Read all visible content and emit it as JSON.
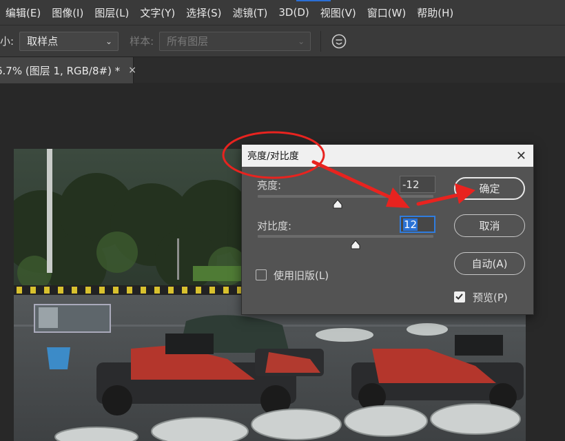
{
  "menubar": {
    "items": [
      {
        "label": "编辑(E)"
      },
      {
        "label": "图像(I)"
      },
      {
        "label": "图层(L)"
      },
      {
        "label": "文字(Y)"
      },
      {
        "label": "选择(S)"
      },
      {
        "label": "滤镜(T)"
      },
      {
        "label": "3D(D)"
      },
      {
        "label": "视图(V)"
      },
      {
        "label": "窗口(W)"
      },
      {
        "label": "帮助(H)"
      }
    ]
  },
  "options": {
    "size_label": "小:",
    "sample_size_value": "取样点",
    "sample_label": "样本:",
    "sample_value": "所有图层",
    "accent_color": "#2b6fd6"
  },
  "tab": {
    "title": "6.7% (图层 1, RGB/8#) *",
    "close_glyph": "×"
  },
  "dialog": {
    "title": "亮度/对比度",
    "close_glyph": "✕",
    "brightness_label": "亮度:",
    "brightness_value": "-12",
    "brightness_level": -12,
    "contrast_label": "对比度:",
    "contrast_value": "12",
    "contrast_level": 12,
    "ok_label": "确定",
    "cancel_label": "取消",
    "auto_label": "自动(A)",
    "legacy_label": "使用旧版(L)",
    "legacy_checked": false,
    "preview_label": "预览(P)",
    "preview_checked": true
  },
  "annotation": {
    "color": "#e8231f",
    "icons": [
      "ellipse-highlight",
      "arrow"
    ]
  }
}
